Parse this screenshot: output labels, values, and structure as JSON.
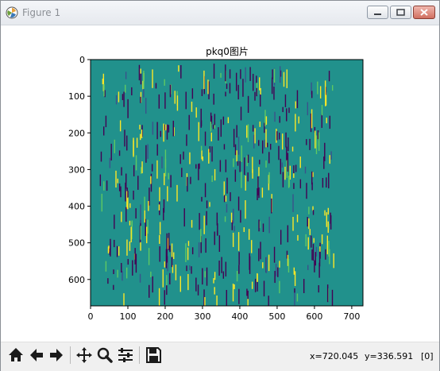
{
  "window": {
    "title": "Figure 1"
  },
  "figure": {
    "title": "pkq0图片",
    "xticks": [
      "0",
      "100",
      "200",
      "300",
      "400",
      "500",
      "600",
      "700"
    ],
    "yticks": [
      "0",
      "100",
      "200",
      "300",
      "400",
      "500",
      "600"
    ]
  },
  "chart_data": {
    "type": "heatmap",
    "title": "pkq0图片",
    "xlim": [
      0,
      730
    ],
    "ylim": [
      672,
      0
    ],
    "xticks": [
      0,
      100,
      200,
      300,
      400,
      500,
      600,
      700
    ],
    "yticks": [
      0,
      100,
      200,
      300,
      400,
      500,
      600
    ],
    "colormap": "viridis",
    "background_value_color": "#21918c",
    "stroke_colors": [
      "#440154",
      "#fde725",
      "#5ec962",
      "#3b528b"
    ]
  },
  "toolbar": {
    "buttons": [
      "home-icon",
      "back-icon",
      "forward-icon",
      "pan-icon",
      "zoom-icon",
      "configure-subplots-icon",
      "save-icon"
    ]
  },
  "status": {
    "x": "x=720.045",
    "y": "y=336.591",
    "value": "[0]"
  }
}
